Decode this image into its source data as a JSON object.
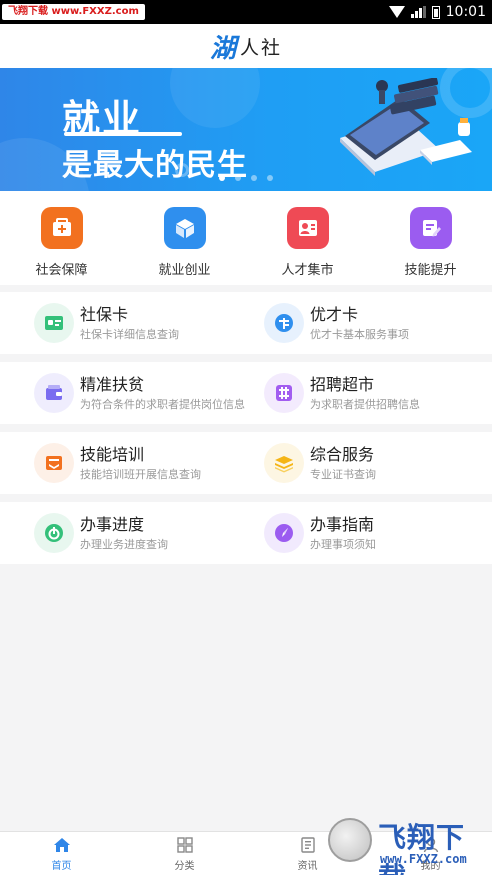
{
  "status_bar": {
    "watermark_text": "飞翔下载 www.FXXZ.com",
    "time": "10:01",
    "icons": [
      "wifi-icon",
      "signal-icon",
      "battery-icon"
    ]
  },
  "header": {
    "logo_glyph": "湖",
    "title": "人社"
  },
  "banner": {
    "line1": "就业",
    "line2": "是最大的民生",
    "page_count": 4,
    "active_index": 0
  },
  "quick_actions": [
    {
      "label": "社会保障",
      "icon": "social-security-icon",
      "color": "#f2711f"
    },
    {
      "label": "就业创业",
      "icon": "cube-icon",
      "color": "#2f8fee"
    },
    {
      "label": "人才集市",
      "icon": "id-card-icon",
      "color": "#ef4a55"
    },
    {
      "label": "技能提升",
      "icon": "edit-note-icon",
      "color": "#9b5cf0"
    }
  ],
  "services": [
    [
      {
        "title": "社保卡",
        "subtitle": "社保卡详细信息查询",
        "icon": "card-icon",
        "color": "#34c07a",
        "bg": "#e8f7ef"
      },
      {
        "title": "优才卡",
        "subtitle": "优才卡基本服务事项",
        "icon": "globe-icon",
        "color": "#2f8fee",
        "bg": "#e7f1fd"
      }
    ],
    [
      {
        "title": "精准扶贫",
        "subtitle": "为符合条件的求职者提供岗位信息",
        "icon": "wallet-icon",
        "color": "#7a6cf0",
        "bg": "#efedfd"
      },
      {
        "title": "招聘超市",
        "subtitle": "为求职者提供招聘信息",
        "icon": "grid-tag-icon",
        "color": "#a25df0",
        "bg": "#f3ebfd"
      }
    ],
    [
      {
        "title": "技能培训",
        "subtitle": "技能培训班开展信息查询",
        "icon": "tray-icon",
        "color": "#f2711f",
        "bg": "#fdf0e7"
      },
      {
        "title": "综合服务",
        "subtitle": "专业证书查询",
        "icon": "layers-icon",
        "color": "#f5b516",
        "bg": "#fdf6e3"
      }
    ],
    [
      {
        "title": "办事进度",
        "subtitle": "办理业务进度查询",
        "icon": "progress-icon",
        "color": "#34c07a",
        "bg": "#e8f7ef"
      },
      {
        "title": "办事指南",
        "subtitle": "办理事项须知",
        "icon": "compass-icon",
        "color": "#9b5cf0",
        "bg": "#f1eafd"
      }
    ]
  ],
  "tabs": [
    {
      "label": "首页",
      "icon": "home-icon",
      "active": true
    },
    {
      "label": "分类",
      "icon": "category-icon",
      "active": false
    },
    {
      "label": "资讯",
      "icon": "news-icon",
      "active": false
    },
    {
      "label": "我的",
      "icon": "profile-icon",
      "active": false
    }
  ],
  "watermark": {
    "brand": "飞翔下载",
    "url": "www.FXXZ.com"
  },
  "colors": {
    "accent": "#2f86e8",
    "banner_start": "#2f86e8",
    "banner_end": "#1aa6f7"
  }
}
